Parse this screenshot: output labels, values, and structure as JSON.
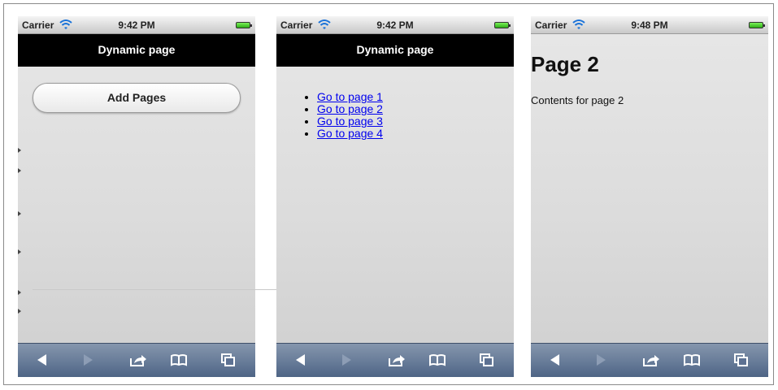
{
  "status_bar": {
    "carrier": "Carrier"
  },
  "screens": [
    {
      "time": "9:42 PM",
      "title": "Dynamic page",
      "add_button_label": "Add Pages"
    },
    {
      "time": "9:42 PM",
      "title": "Dynamic page",
      "links": [
        "Go to page 1",
        "Go to page 2",
        "Go to page 3",
        "Go to page 4"
      ]
    },
    {
      "time": "9:48 PM",
      "heading": "Page 2",
      "contents": "Contents for page 2"
    }
  ],
  "toolbar": {
    "icons": [
      "back-icon",
      "forward-icon",
      "share-icon",
      "bookmarks-icon",
      "tabs-icon"
    ],
    "color": "#5d7192"
  }
}
